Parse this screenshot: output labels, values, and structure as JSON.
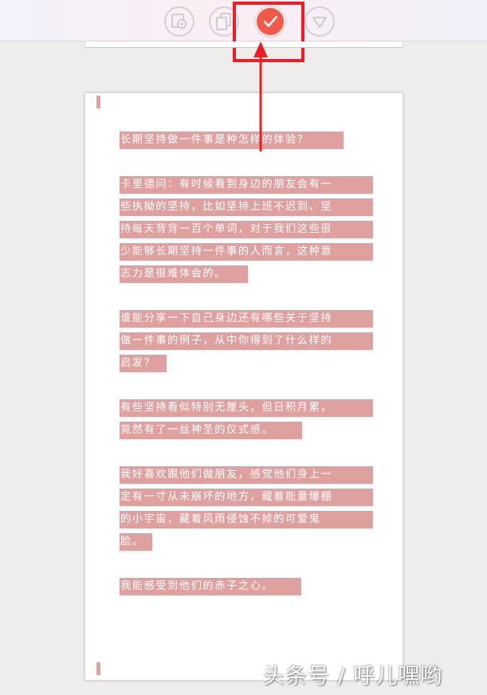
{
  "toolbar": {
    "buttons": [
      {
        "name": "picture-icon"
      },
      {
        "name": "copy-icon"
      },
      {
        "name": "check-icon",
        "active": true
      },
      {
        "name": "triangle-down-icon"
      }
    ],
    "accent_color": "#f15a4a",
    "highlight_color": "#ee1c25"
  },
  "document": {
    "highlight_color": "#dfa19f",
    "lines": [
      "长期坚持做一件事是种怎样的体验？",
      "卡里德问：有时候看到身边的朋友会有一",
      "些执拗的坚持，比如坚持上班不迟到、坚",
      "持每天背背一百个单词，对于我们这些很",
      "少能够长期坚持一件事的人而言，这种意",
      "志力是很难体会的。",
      "谁能分享一下自己身边还有哪些关于坚持",
      "做一件事的例子，从中你得到了什么样的",
      "启发？",
      "有些坚持看似特别无厘头，但日积月累，",
      "竟然有了一丝神圣的仪式感。",
      "我好喜欢跟他们做朋友，感觉他们身上一",
      "定有一寸从未崩坏的地方，藏着能量爆棚",
      "的小宇宙，藏着风雨侵蚀不掉的可爱鬼",
      "脸。",
      "我能感受到他们的赤子之心。"
    ]
  },
  "watermark": "头条号 / 呼儿嘿哟"
}
